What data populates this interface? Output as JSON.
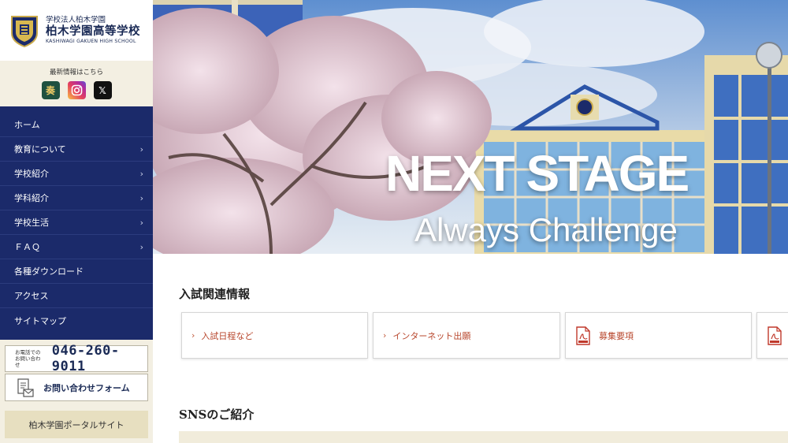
{
  "school": {
    "subtitle": "学校法人柏木学園",
    "name": "柏木学園高等学校",
    "name_en": "KASHIWAGI GAKUEN HIGH SCHOOL"
  },
  "sns": {
    "label": "最新情報はこちら",
    "kanade_glyph": "奏",
    "x_glyph": "𝕏",
    "icons": [
      "kanade-app-icon",
      "instagram-icon",
      "x-icon"
    ]
  },
  "nav": [
    {
      "label": "ホーム",
      "chevron": ""
    },
    {
      "label": "教育について",
      "chevron": "›"
    },
    {
      "label": "学校紹介",
      "chevron": "›"
    },
    {
      "label": "学科紹介",
      "chevron": "›"
    },
    {
      "label": "学校生活",
      "chevron": "›"
    },
    {
      "label": "ＦＡＱ",
      "chevron": "›"
    },
    {
      "label": "各種ダウンロード",
      "chevron": ""
    },
    {
      "label": "アクセス",
      "chevron": ""
    },
    {
      "label": "サイトマップ",
      "chevron": ""
    }
  ],
  "contact": {
    "tel_label_1": "お電話での",
    "tel_label_2": "お問い合わせ",
    "tel_number": "046-260-9011",
    "form_label": "お問い合わせフォーム"
  },
  "portal_label": "柏木学園ポータルサイト",
  "hero": {
    "title": "NEXT STAGE",
    "subtitle": "Always Challenge"
  },
  "exam": {
    "title": "入試関連情報",
    "cards": [
      {
        "label": "入試日程など",
        "icon": "chevron-right-icon"
      },
      {
        "label": "インターネット出願",
        "icon": "chevron-right-icon"
      },
      {
        "label": "募集要項",
        "icon": "pdf-icon"
      }
    ]
  },
  "sns_section_title": "SNSのご紹介",
  "colors": {
    "navy": "#1b2a6a",
    "beige": "#f3efe2",
    "accent_red": "#b8472d"
  }
}
